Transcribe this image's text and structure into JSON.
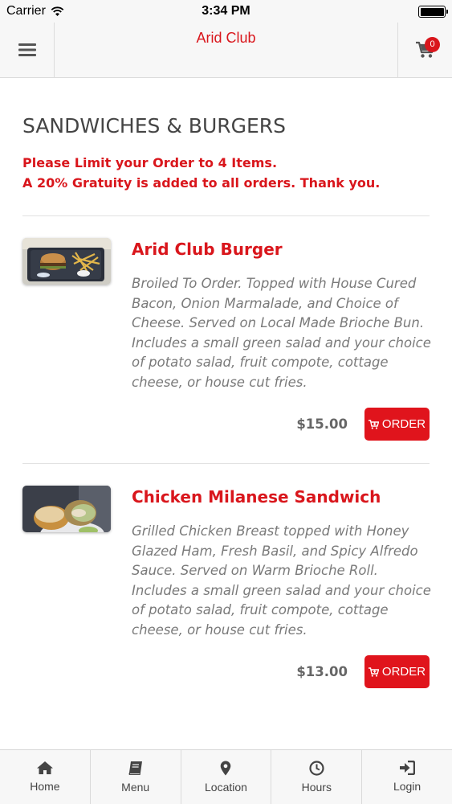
{
  "status_bar": {
    "carrier": "Carrier",
    "time": "3:34 PM"
  },
  "nav": {
    "title": "Arid Club",
    "cart_count": "0"
  },
  "category": {
    "title": "SANDWICHES & BURGERS",
    "notice_line1": "Please Limit your Order to 4 Items.",
    "notice_line2": "A 20% Gratuity is added to all orders. Thank you."
  },
  "items": [
    {
      "name": "Arid Club Burger",
      "description": "Broiled To Order. Topped with House Cured Bacon, Onion Marmalade, and Choice of Cheese. Served on Local Made Brioche Bun. Includes a small green salad and your choice of potato salad, fruit compote, cottage cheese, or house cut fries.",
      "price": "$15.00",
      "order_label": "ORDER"
    },
    {
      "name": "Chicken Milanese Sandwich",
      "description": "Grilled Chicken Breast topped with Honey Glazed Ham, Fresh Basil, and Spicy Alfredo Sauce. Served on Warm Brioche Roll. Includes a small green salad and your choice of potato salad, fruit compote, cottage cheese, or house cut fries.",
      "price": "$13.00",
      "order_label": "ORDER"
    }
  ],
  "tabs": [
    {
      "label": "Home",
      "icon": "home-icon"
    },
    {
      "label": "Menu",
      "icon": "book-icon"
    },
    {
      "label": "Location",
      "icon": "map-pin-icon"
    },
    {
      "label": "Hours",
      "icon": "clock-icon"
    },
    {
      "label": "Login",
      "icon": "sign-in-icon"
    }
  ],
  "colors": {
    "brand_red": "#d9161c",
    "order_button": "#e0141c"
  }
}
